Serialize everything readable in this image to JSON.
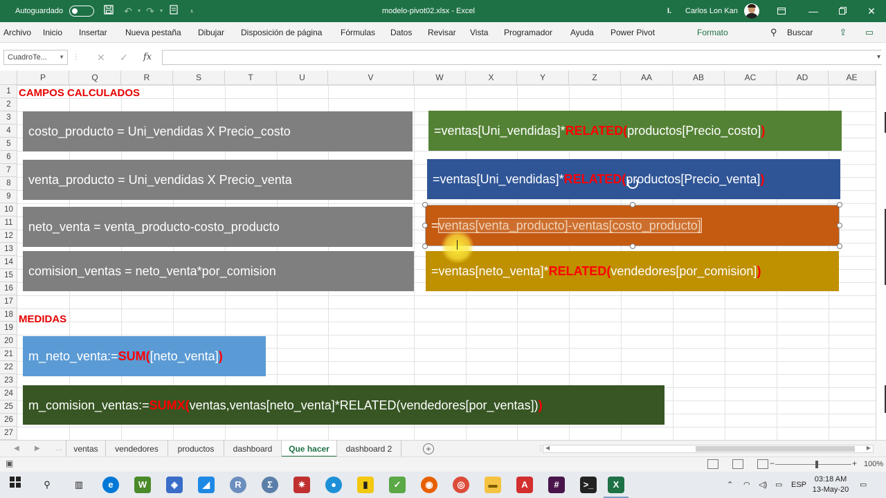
{
  "titlebar": {
    "autosave_label": "Autoguardado",
    "title": "modelo-pivot02.xlsx  -  Excel",
    "search_hint_prefix": "I.",
    "user_name": "Carlos Lon Kan"
  },
  "menu": {
    "items": [
      "Archivo",
      "Inicio",
      "Insertar",
      "Nueva pestaña",
      "Dibujar",
      "Disposición de página",
      "Fórmulas",
      "Datos",
      "Revisar",
      "Vista",
      "Programador",
      "Ayuda",
      "Power Pivot",
      "Formato"
    ],
    "search": "Buscar"
  },
  "formula_bar": {
    "name_box": "CuadroTe...",
    "fx": "fx",
    "cancel": "✕",
    "confirm": "✓",
    "content": ""
  },
  "grid": {
    "columns": [
      "P",
      "Q",
      "R",
      "S",
      "T",
      "U",
      "V",
      "W",
      "X",
      "Y",
      "Z",
      "AA",
      "AB",
      "AC",
      "AD",
      "AE"
    ],
    "rows": [
      "1",
      "2",
      "3",
      "4",
      "5",
      "6",
      "7",
      "8",
      "9",
      "10",
      "11",
      "12",
      "13",
      "14",
      "15",
      "16",
      "17",
      "18",
      "19",
      "20",
      "21",
      "22",
      "23",
      "24",
      "25",
      "26",
      "27"
    ]
  },
  "content": {
    "section_calc": "CAMPOS CALCULADOS",
    "section_measures": "MEDIDAS",
    "calc_boxes": [
      {
        "text": "costo_producto = Uni_vendidas X Precio_costo",
        "color": "#7f7f7f"
      },
      {
        "text": "venta_producto = Uni_vendidas X Precio_venta",
        "color": "#7f7f7f"
      },
      {
        "text": "neto_venta = venta_producto-costo_producto",
        "color": "#7f7f7f"
      },
      {
        "text": "comision_ventas = neto_venta*por_comision",
        "color": "#7f7f7f"
      }
    ],
    "formula_boxes": [
      {
        "pre": "=ventas[Uni_vendidas]*",
        "fn": "RELATED",
        "open": "(",
        "arg": "productos[Precio_costo]",
        "close": ")",
        "color": "#548235"
      },
      {
        "pre": "=ventas[Uni_vendidas]*",
        "fn": "RELATED",
        "open": "(",
        "arg": "productos[Precio_venta]",
        "close": ")",
        "color": "#2f5597"
      },
      {
        "pre": "=",
        "editing": "ventas[venta_producto]-ventas[costo_producto]",
        "color": "#c55a11"
      },
      {
        "pre": "=ventas[neto_venta]*",
        "fn": "RELATED",
        "open": "(",
        "arg": "vendedores[por_comision]",
        "close": ")",
        "color": "#bf9000"
      }
    ],
    "measures": [
      {
        "pre": "m_neto_venta:=",
        "fn": "SUM",
        "open": "(",
        "arg": "[neto_venta]",
        "close": ")",
        "color": "#5b9bd5"
      },
      {
        "pre": "m_comision_ventas:=",
        "fn": "SUMX",
        "open": "(",
        "arg": "ventas,ventas[neto_venta]*RELATED(vendedores[por_ventas])",
        "close": ")",
        "color": "#375623"
      }
    ]
  },
  "sheets": {
    "tabs": [
      "ventas",
      "vendedores",
      "productos",
      "dashboard",
      "Que hacer",
      "dashboard 2"
    ],
    "active": "Que hacer"
  },
  "statusbar": {
    "zoom": "100%"
  },
  "taskbar": {
    "language": "ESP",
    "time": "03:18 AM",
    "date": "13-May-20"
  }
}
